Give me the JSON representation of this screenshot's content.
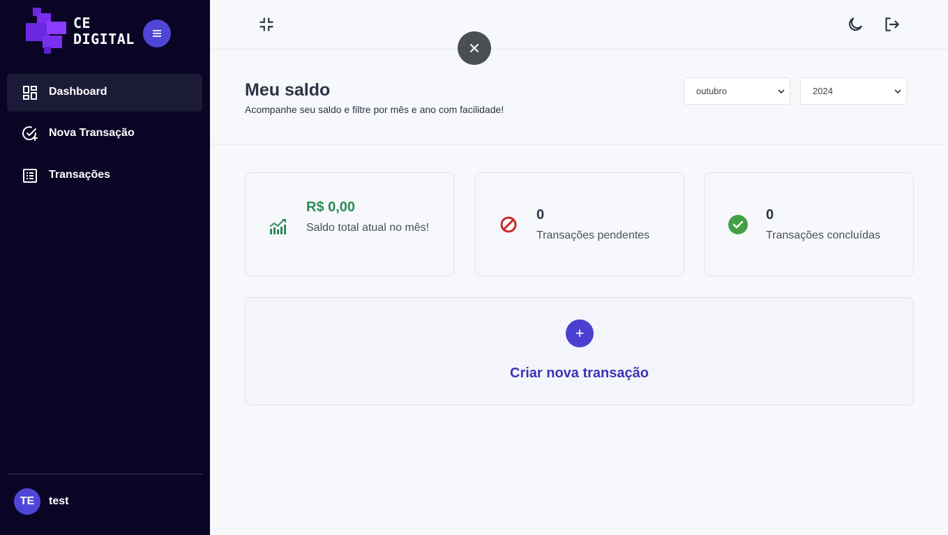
{
  "brand": {
    "line1": "CE",
    "line2": "DIGITAL",
    "accent": "#4f46d8"
  },
  "sidebar": {
    "items": [
      {
        "label": "Dashboard",
        "icon": "dashboard-grid-icon",
        "active": true
      },
      {
        "label": "Nova Transação",
        "icon": "check-circle-plus-icon",
        "active": false
      },
      {
        "label": "Transações",
        "icon": "list-document-icon",
        "active": false
      }
    ],
    "user": {
      "initials": "TE",
      "name": "test"
    }
  },
  "header": {
    "icons": [
      "collapse-icon",
      "close-icon",
      "moon-icon",
      "logout-icon"
    ]
  },
  "page": {
    "title": "Meu saldo",
    "subtitle": "Acompanhe seu saldo e filtre por mês e ano com facilidade!",
    "month_select": "outubro",
    "year_select": "2024"
  },
  "cards": [
    {
      "value": "R$ 0,00",
      "label": "Saldo total atual no mês!",
      "icon": "chart-up-icon",
      "color": "#2e8b57"
    },
    {
      "value": "0",
      "label": "Transações pendentes",
      "icon": "prohibited-icon",
      "color": "#c62828"
    },
    {
      "value": "0",
      "label": "Transações concluídas",
      "icon": "check-circle-icon",
      "color": "#43a047"
    }
  ],
  "create": {
    "label": "Criar nova transação",
    "button": "+"
  }
}
